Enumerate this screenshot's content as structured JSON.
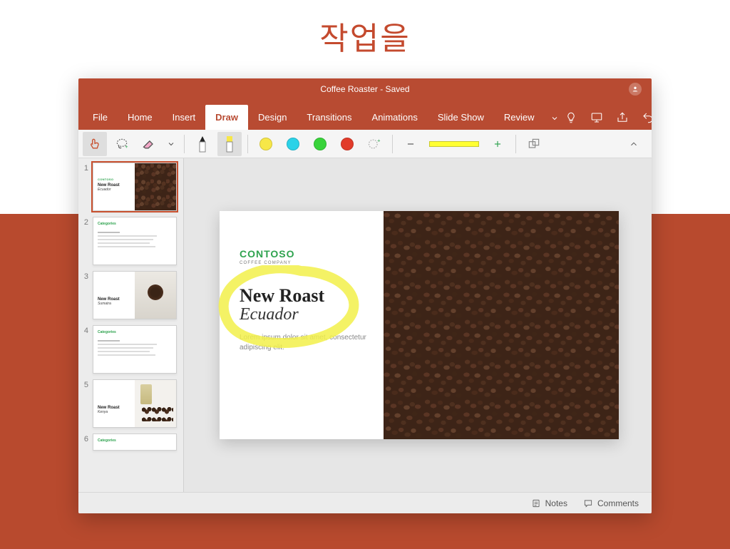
{
  "hero_title": "작업을",
  "colors": {
    "brand": "#b84b32",
    "accent_green": "#2fa34f",
    "highlighter": "#f2f04a"
  },
  "window": {
    "title": "Coffee Roaster - Saved"
  },
  "ribbon": {
    "tabs": [
      {
        "id": "file",
        "label": "File"
      },
      {
        "id": "home",
        "label": "Home"
      },
      {
        "id": "insert",
        "label": "Insert"
      },
      {
        "id": "draw",
        "label": "Draw",
        "active": true
      },
      {
        "id": "design",
        "label": "Design"
      },
      {
        "id": "transitions",
        "label": "Transitions"
      },
      {
        "id": "animations",
        "label": "Animations"
      },
      {
        "id": "slideshow",
        "label": "Slide Show"
      },
      {
        "id": "review",
        "label": "Review"
      }
    ],
    "more_icon": "chevron-down-icon",
    "right_icons": [
      "lightbulb-icon",
      "present-icon",
      "share-icon",
      "undo-icon",
      "redo-icon"
    ]
  },
  "draw_toolbar": {
    "tools": [
      {
        "id": "touch-draw",
        "icon": "finger-draw-icon",
        "selected": true
      },
      {
        "id": "lasso",
        "icon": "lasso-select-icon"
      },
      {
        "id": "eraser",
        "icon": "eraser-icon"
      },
      {
        "id": "eraser-menu",
        "icon": "chevron-down-icon"
      },
      {
        "id": "pen",
        "icon": "pen-icon"
      },
      {
        "id": "highlighter",
        "icon": "highlighter-icon",
        "selected": true
      }
    ],
    "colors": [
      "#f7e748",
      "#2bd2e8",
      "#38d33a",
      "#e23b2a"
    ],
    "add_color_icon": "add-color-icon",
    "width": {
      "minus": "minus-icon",
      "plus": "plus-icon",
      "swatch": "#ffff33"
    },
    "ink_to_shape_icon": "ink-to-shape-icon"
  },
  "thumbnails": [
    {
      "n": 1,
      "kind": "title",
      "title": "New Roast",
      "sub": "Ecuador",
      "selected": true
    },
    {
      "n": 2,
      "kind": "text",
      "head": "Categories"
    },
    {
      "n": 3,
      "kind": "hands",
      "title": "New Roast",
      "sub": "Sumatra"
    },
    {
      "n": 4,
      "kind": "text",
      "head": "Categories"
    },
    {
      "n": 5,
      "kind": "bag",
      "title": "New Roast",
      "sub": "Kenya"
    },
    {
      "n": 6,
      "kind": "text",
      "head": "Categories"
    }
  ],
  "slide": {
    "logo": "CONTOSO",
    "logo_sub": "COFFEE COMPANY",
    "title": "New Roast",
    "subtitle": "Ecuador",
    "body": "Lorem ipsum dolor sit amet, consectetur adipiscing elit."
  },
  "statusbar": {
    "notes": "Notes",
    "comments": "Comments"
  }
}
